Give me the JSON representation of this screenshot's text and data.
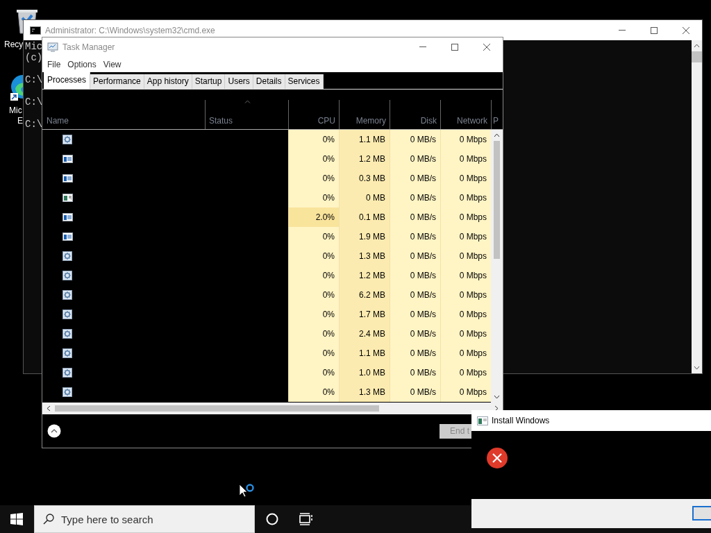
{
  "desktop": {
    "icons": [
      {
        "kind": "recycle-bin",
        "label_lines": [
          "Recy"
        ]
      },
      {
        "kind": "browser",
        "label_lines": [
          "Mic",
          "E"
        ]
      }
    ]
  },
  "cmd_window": {
    "title": "Administrator: C:\\Windows\\system32\\cmd.exe",
    "lines": [
      {
        "kind": "output",
        "text": "Mic"
      },
      {
        "kind": "output",
        "text": "(c)"
      },
      {
        "kind": "prompt",
        "text": "C:\\"
      },
      {
        "kind": "prompt",
        "text": "C:\\"
      },
      {
        "kind": "prompt",
        "text": "C:\\"
      }
    ]
  },
  "task_manager": {
    "title": "Task Manager",
    "menu": [
      "File",
      "Options",
      "View"
    ],
    "tabs": [
      {
        "label": "Processes",
        "selected": true
      },
      {
        "label": "Performance",
        "selected": false
      },
      {
        "label": "App history",
        "selected": false
      },
      {
        "label": "Startup",
        "selected": false
      },
      {
        "label": "Users",
        "selected": false
      },
      {
        "label": "Details",
        "selected": false
      },
      {
        "label": "Services",
        "selected": false
      }
    ],
    "columns": [
      {
        "label": "Name",
        "sorted": false
      },
      {
        "label": "Status",
        "sorted": true
      },
      {
        "label": "CPU",
        "sorted": false
      },
      {
        "label": "Memory",
        "sorted": false
      },
      {
        "label": "Disk",
        "sorted": false
      },
      {
        "label": "Network",
        "sorted": false
      },
      {
        "label": "P",
        "sorted": false
      }
    ],
    "rows": [
      {
        "kind": "service",
        "cpu": "0%",
        "cpu_busy": false,
        "memory": "1.1 MB",
        "disk": "0 MB/s",
        "network": "0 Mbps"
      },
      {
        "kind": "app",
        "cpu": "0%",
        "cpu_busy": false,
        "memory": "1.2 MB",
        "disk": "0 MB/s",
        "network": "0 Mbps"
      },
      {
        "kind": "app",
        "cpu": "0%",
        "cpu_busy": false,
        "memory": "0.3 MB",
        "disk": "0 MB/s",
        "network": "0 Mbps"
      },
      {
        "kind": "installer",
        "cpu": "0%",
        "cpu_busy": false,
        "memory": "0 MB",
        "disk": "0 MB/s",
        "network": "0 Mbps"
      },
      {
        "kind": "app",
        "cpu": "2.0%",
        "cpu_busy": true,
        "memory": "0.1 MB",
        "disk": "0 MB/s",
        "network": "0 Mbps"
      },
      {
        "kind": "app",
        "cpu": "0%",
        "cpu_busy": false,
        "memory": "1.9 MB",
        "disk": "0 MB/s",
        "network": "0 Mbps"
      },
      {
        "kind": "service",
        "cpu": "0%",
        "cpu_busy": false,
        "memory": "1.3 MB",
        "disk": "0 MB/s",
        "network": "0 Mbps"
      },
      {
        "kind": "service",
        "cpu": "0%",
        "cpu_busy": false,
        "memory": "1.2 MB",
        "disk": "0 MB/s",
        "network": "0 Mbps"
      },
      {
        "kind": "service",
        "cpu": "0%",
        "cpu_busy": false,
        "memory": "6.2 MB",
        "disk": "0 MB/s",
        "network": "0 Mbps"
      },
      {
        "kind": "service",
        "cpu": "0%",
        "cpu_busy": false,
        "memory": "1.7 MB",
        "disk": "0 MB/s",
        "network": "0 Mbps"
      },
      {
        "kind": "service",
        "cpu": "0%",
        "cpu_busy": false,
        "memory": "2.4 MB",
        "disk": "0 MB/s",
        "network": "0 Mbps"
      },
      {
        "kind": "service",
        "cpu": "0%",
        "cpu_busy": false,
        "memory": "1.1 MB",
        "disk": "0 MB/s",
        "network": "0 Mbps"
      },
      {
        "kind": "service",
        "cpu": "0%",
        "cpu_busy": false,
        "memory": "1.0 MB",
        "disk": "0 MB/s",
        "network": "0 Mbps"
      },
      {
        "kind": "service",
        "cpu": "0%",
        "cpu_busy": false,
        "memory": "1.3 MB",
        "disk": "0 MB/s",
        "network": "0 Mbps"
      }
    ],
    "end_task_button": "End t"
  },
  "install_dialog": {
    "title": "Install Windows"
  },
  "taskbar": {
    "search": {
      "placeholder": "Type here to search"
    }
  }
}
